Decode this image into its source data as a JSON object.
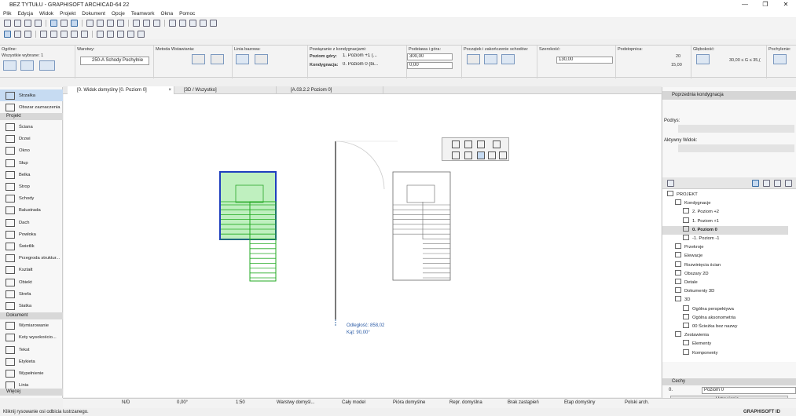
{
  "window": {
    "title": "BEZ TYTUŁU - GRAPHISOFT ARCHICAD-64 22",
    "min": "—",
    "max": "❐",
    "close": "✕"
  },
  "menu": [
    "Plik",
    "Edycja",
    "Widok",
    "Projekt",
    "Dokument",
    "Opcje",
    "Teamwork",
    "Okna",
    "Pomoc"
  ],
  "infobox": {
    "general_label": "Ogólne:",
    "selected_label": "Wszystkie wybrane: 1",
    "layer_label": "Warstwy:",
    "layer_value": "250-A Schody Pochylnie",
    "method_label": "Metoda Wstawiania:",
    "baseline_label": "Linia bazowa:",
    "floor_label": "Powiązanie z kondygnacjami:",
    "top_label": "Poziom góry:",
    "top_value": "1. Poziom +1 (...",
    "floor_row_label": "Kondygnacja:",
    "floor_value": "0. Poziom 0 (bi...",
    "base_label": "Podstawa i góra:",
    "base_top": "300,00",
    "base_bottom": "0,00",
    "start_end_label": "Początek i zakończenie schodów:",
    "width_label": "Szerokość:",
    "width_value": "130,00",
    "riser_label": "Podstopnica:",
    "riser_count": "20",
    "riser_height": "15,00",
    "depth_label": "Głębokość:",
    "depth_value": "30,00 ≤ G ≤ 35,(",
    "slope_label": "Pochylenie:"
  },
  "tabs": [
    {
      "label": "[0. Widok domyślny [0. Poziom 0]",
      "close": "×"
    },
    {
      "label": "[3D / Wszystko]"
    },
    {
      "label": "[A.03.2.2 Poziom 0]"
    }
  ],
  "toolbox": {
    "arrow": "Strzałka",
    "marquee": "Obszar zaznaczenia",
    "section_project": "Projekt",
    "project_items": [
      "Ściana",
      "Drzwi",
      "Okno",
      "Słup",
      "Belka",
      "Strop",
      "Schody",
      "Balustrada",
      "Dach",
      "Powłoka",
      "Świetlik",
      "Przegroda struktur...",
      "Kształt",
      "Obiekt",
      "Strefa",
      "Siatka"
    ],
    "section_document": "Dokument",
    "document_items": [
      "Wymiarowanie",
      "Koty wysokościo...",
      "Tekst",
      "Etykieta",
      "Wypełnienie",
      "Linia"
    ],
    "more": "Więcej"
  },
  "canvas": {
    "distance_label": "Odległość:",
    "distance_value": "858,02",
    "angle_label": "Kąt:",
    "angle_value": "90,00°"
  },
  "right_panel": {
    "prev_floor": "Poprzednia kondygnacja",
    "layer_label": "Podrys:",
    "active_view": "Aktywny Widok:",
    "tree": [
      {
        "label": "PROJEKT",
        "indent": 0
      },
      {
        "label": "Kondygnacje",
        "indent": 1
      },
      {
        "label": "2. Poziom +2",
        "indent": 2
      },
      {
        "label": "1. Poziom +1",
        "indent": 2
      },
      {
        "label": "0. Poziom 0",
        "indent": 2,
        "selected": true
      },
      {
        "label": "-1. Poziom -1",
        "indent": 2
      },
      {
        "label": "Przekroje",
        "indent": 1
      },
      {
        "label": "Elewacje",
        "indent": 1
      },
      {
        "label": "Rozwinięcia ścian",
        "indent": 1
      },
      {
        "label": "Obszary 2D",
        "indent": 1
      },
      {
        "label": "Detale",
        "indent": 1
      },
      {
        "label": "Dokumenty 3D",
        "indent": 1
      },
      {
        "label": "3D",
        "indent": 1
      },
      {
        "label": "Ogólna perspektywa",
        "indent": 2
      },
      {
        "label": "Ogólna aksonometria",
        "indent": 2
      },
      {
        "label": "00 Ścieżka bez nazwy",
        "indent": 2
      },
      {
        "label": "Zestawienia",
        "indent": 1
      },
      {
        "label": "Elementy",
        "indent": 2
      },
      {
        "label": "Komponenty",
        "indent": 2
      }
    ],
    "props_head": "Cechy",
    "props_id": "0.",
    "props_name": "Poziom 0",
    "settings": "Ustawienia..."
  },
  "status": {
    "nd": "N/D",
    "angle": "0,00°",
    "scale": "1:50",
    "layers": "Warstwy domyśl...",
    "model": "Cały model",
    "pens": "Pióra domyślne",
    "repr": "Repr. domyślna",
    "overrides": "Brak zastąpień",
    "phase": "Etap domyślny",
    "renovation": "Polski arch.",
    "brand": "GRAPHISOFT ID"
  },
  "hint": "Kliknij rysowanie osi odbicia lustrzanego."
}
